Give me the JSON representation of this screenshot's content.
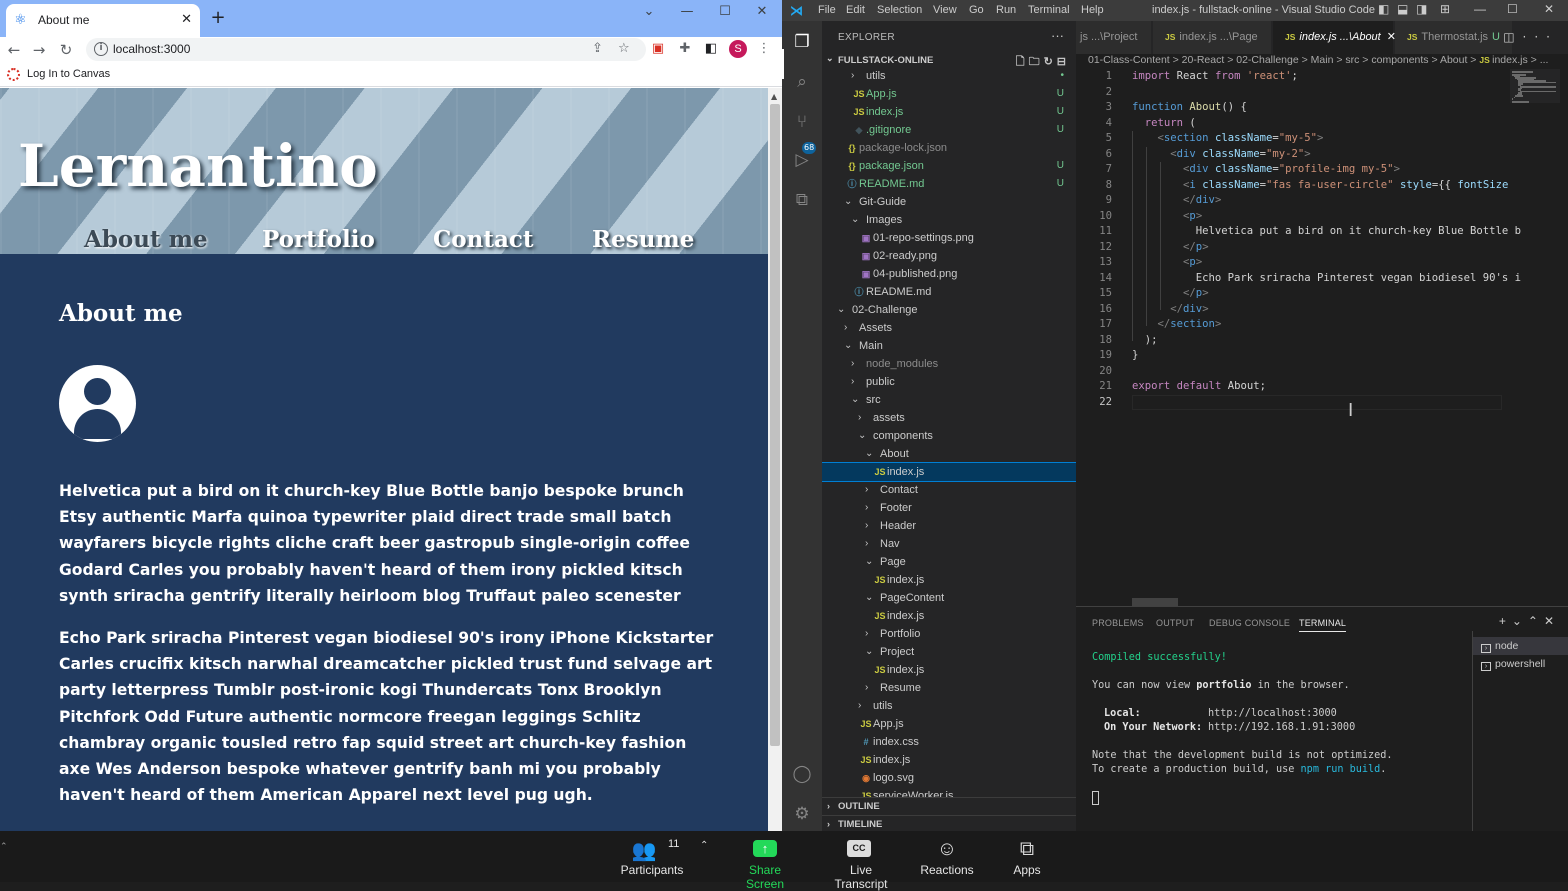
{
  "chrome": {
    "tab_title": "About me",
    "new_tab": "+",
    "controls": {
      "minimize": "—",
      "maximize": "☐",
      "close": "✕",
      "tablist": "⌄"
    },
    "address": "localhost:3000",
    "bookmark": "Log In to Canvas",
    "profile_initial": "S"
  },
  "site": {
    "brand": "Lernantino",
    "nav": [
      "About me",
      "Portfolio",
      "Contact",
      "Resume"
    ],
    "active_nav": "About me",
    "heading": "About me",
    "paragraphs": [
      "Helvetica put a bird on it church-key Blue Bottle banjo bespoke brunch Etsy authentic Marfa quinoa typewriter plaid direct trade small batch wayfarers bicycle rights cliche craft beer gastropub single-origin coffee Godard Carles you probably haven't heard of them irony pickled kitsch synth sriracha gentrify literally heirloom blog Truffaut paleo scenester",
      "Echo Park sriracha Pinterest vegan biodiesel 90's irony iPhone Kickstarter Carles crucifix kitsch narwhal dreamcatcher pickled trust fund selvage art party letterpress Tumblr post-ironic kogi Thundercats Tonx Brooklyn Pitchfork Odd Future authentic normcore freegan leggings Schlitz chambray organic tousled retro fap squid street art church-key fashion axe Wes Anderson bespoke whatever gentrify banh mi you probably haven't heard of them American Apparel next level pug ugh."
    ]
  },
  "vscode": {
    "menu": [
      "File",
      "Edit",
      "Selection",
      "View",
      "Go",
      "Run",
      "Terminal",
      "Help"
    ],
    "window_title": "index.js - fullstack-online - Visual Studio Code",
    "scm_badge": "68",
    "explorer_title": "EXPLORER",
    "workspace": "FULLSTACK-ONLINE",
    "tree": [
      {
        "label": "utils",
        "kind": "folder-closed",
        "indent": 3,
        "status": "•"
      },
      {
        "label": "App.js",
        "kind": "js",
        "indent": 3,
        "status": "U"
      },
      {
        "label": "index.js",
        "kind": "js",
        "indent": 3,
        "status": "U"
      },
      {
        "label": ".gitignore",
        "kind": "git",
        "indent": 3,
        "status": "U"
      },
      {
        "label": "package-lock.json",
        "kind": "json",
        "indent": 2,
        "status": ""
      },
      {
        "label": "package.json",
        "kind": "json",
        "indent": 2,
        "status": "U"
      },
      {
        "label": "README.md",
        "kind": "md",
        "indent": 2,
        "status": "U"
      },
      {
        "label": "Git-Guide",
        "kind": "folder-open",
        "indent": 2,
        "status": ""
      },
      {
        "label": "Images",
        "kind": "folder-open",
        "indent": 3,
        "status": ""
      },
      {
        "label": "01-repo-settings.png",
        "kind": "png",
        "indent": 4,
        "status": ""
      },
      {
        "label": "02-ready.png",
        "kind": "png",
        "indent": 4,
        "status": ""
      },
      {
        "label": "04-published.png",
        "kind": "png",
        "indent": 4,
        "status": ""
      },
      {
        "label": "README.md",
        "kind": "md",
        "indent": 3,
        "status": ""
      },
      {
        "label": "02-Challenge",
        "kind": "folder-open",
        "indent": 1,
        "status": ""
      },
      {
        "label": "Assets",
        "kind": "folder-closed",
        "indent": 2,
        "status": ""
      },
      {
        "label": "Main",
        "kind": "folder-open",
        "indent": 2,
        "status": ""
      },
      {
        "label": "node_modules",
        "kind": "folder-closed-ignored",
        "indent": 3,
        "status": ""
      },
      {
        "label": "public",
        "kind": "folder-closed",
        "indent": 3,
        "status": ""
      },
      {
        "label": "src",
        "kind": "folder-open",
        "indent": 3,
        "status": ""
      },
      {
        "label": "assets",
        "kind": "folder-closed",
        "indent": 4,
        "status": ""
      },
      {
        "label": "components",
        "kind": "folder-open",
        "indent": 4,
        "status": ""
      },
      {
        "label": "About",
        "kind": "folder-open",
        "indent": 5,
        "status": ""
      },
      {
        "label": "index.js",
        "kind": "js-selected",
        "indent": 6,
        "status": ""
      },
      {
        "label": "Contact",
        "kind": "folder-closed",
        "indent": 5,
        "status": ""
      },
      {
        "label": "Footer",
        "kind": "folder-closed",
        "indent": 5,
        "status": ""
      },
      {
        "label": "Header",
        "kind": "folder-closed",
        "indent": 5,
        "status": ""
      },
      {
        "label": "Nav",
        "kind": "folder-closed",
        "indent": 5,
        "status": ""
      },
      {
        "label": "Page",
        "kind": "folder-open",
        "indent": 5,
        "status": ""
      },
      {
        "label": "index.js",
        "kind": "js",
        "indent": 6,
        "status": ""
      },
      {
        "label": "PageContent",
        "kind": "folder-open",
        "indent": 5,
        "status": ""
      },
      {
        "label": "index.js",
        "kind": "js",
        "indent": 6,
        "status": ""
      },
      {
        "label": "Portfolio",
        "kind": "folder-closed",
        "indent": 5,
        "status": ""
      },
      {
        "label": "Project",
        "kind": "folder-open",
        "indent": 5,
        "status": ""
      },
      {
        "label": "index.js",
        "kind": "js",
        "indent": 6,
        "status": ""
      },
      {
        "label": "Resume",
        "kind": "folder-closed",
        "indent": 5,
        "status": ""
      },
      {
        "label": "utils",
        "kind": "folder-closed",
        "indent": 4,
        "status": ""
      },
      {
        "label": "App.js",
        "kind": "js",
        "indent": 4,
        "status": ""
      },
      {
        "label": "index.css",
        "kind": "css",
        "indent": 4,
        "status": ""
      },
      {
        "label": "index.js",
        "kind": "js",
        "indent": 4,
        "status": ""
      },
      {
        "label": "logo.svg",
        "kind": "svg",
        "indent": 4,
        "status": ""
      },
      {
        "label": "serviceWorker.js",
        "kind": "js",
        "indent": 4,
        "status": ""
      }
    ],
    "outline": "OUTLINE",
    "timeline": "TIMELINE",
    "tabs": [
      {
        "label": "js ...\\Project",
        "js": false,
        "active": false,
        "u": false
      },
      {
        "label": "index.js ...\\Page",
        "js": true,
        "active": false,
        "u": false
      },
      {
        "label": "index.js ...\\About",
        "js": true,
        "active": true,
        "u": false
      },
      {
        "label": "Thermostat.js",
        "js": true,
        "active": false,
        "u": true
      }
    ],
    "breadcrumb": "01-Class-Content > 20-React > 02-Challenge > Main > src > components > About > ",
    "breadcrumb_file": "index.js > ...",
    "code_lines": [
      "import React from 'react';",
      "",
      "function About() {",
      "  return (",
      "    <section className=\"my-5\">",
      "      <div className=\"my-2\">",
      "        <div className=\"profile-img my-5\">",
      "        <i className=\"fas fa-user-circle\" style={{ fontSize",
      "        </div>",
      "        <p>",
      "          Helvetica put a bird on it church-key Blue Bottle b",
      "        </p>",
      "        <p>",
      "          Echo Park sriracha Pinterest vegan biodiesel 90's i",
      "        </p>",
      "      </div>",
      "    </section>",
      "  );",
      "}",
      "",
      "export default About;",
      ""
    ],
    "panel_tabs": [
      "PROBLEMS",
      "OUTPUT",
      "DEBUG CONSOLE",
      "TERMINAL"
    ],
    "terminal": {
      "compiled": "Compiled successfully!",
      "view_pre": "You can now view ",
      "view_app": "portfolio",
      "view_post": " in the browser.",
      "local_label": "Local:",
      "local_url": "http://localhost:3000",
      "network_label": "On Your Network:",
      "network_url": "http://192.168.1.91:3000",
      "note1": "Note that the development build is not optimized.",
      "note2_pre": "To create a production build, use ",
      "note2_cmd": "npm run build",
      "note2_post": "."
    },
    "terminals": [
      "node",
      "powershell"
    ]
  },
  "zoom": {
    "participants_label": "Participants",
    "participants_count": "11",
    "share_label": "Share Screen",
    "transcript_label": "Live Transcript",
    "transcript_icon": "CC",
    "reactions_label": "Reactions",
    "apps_label": "Apps"
  },
  "colors": {
    "site_bg": "#213a5f",
    "vscode_bg": "#1e1e1e",
    "share_green": "#23d959",
    "selection": "#04395e"
  }
}
